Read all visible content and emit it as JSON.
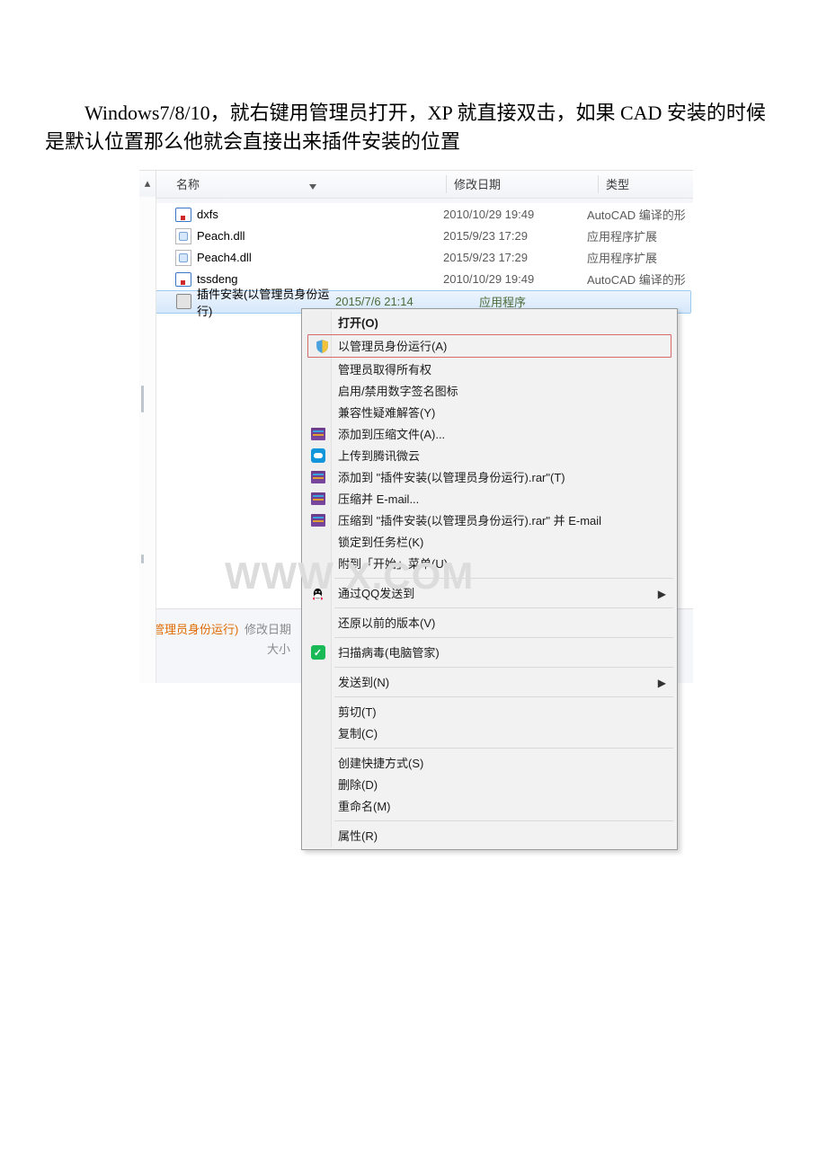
{
  "instruction": "Windows7/8/10，就右键用管理员打开，XP 就直接双击，如果 CAD 安装的时候是默认位置那么他就会直接出来插件安装的位置",
  "headers": {
    "name": "名称",
    "date": "修改日期",
    "type": "类型"
  },
  "files": [
    {
      "icon": "shx",
      "name": "dxfs",
      "date": "2010/10/29 19:49",
      "type": "AutoCAD 编译的形"
    },
    {
      "icon": "dll",
      "name": "Peach.dll",
      "date": "2015/9/23 17:29",
      "type": "应用程序扩展"
    },
    {
      "icon": "dll",
      "name": "Peach4.dll",
      "date": "2015/9/23 17:29",
      "type": "应用程序扩展"
    },
    {
      "icon": "shx",
      "name": "tssdeng",
      "date": "2010/10/29 19:49",
      "type": "AutoCAD 编译的形"
    },
    {
      "icon": "exe",
      "name": "插件安装(以管理员身份运行)",
      "date": "2015/7/6 21:14",
      "type": "应用程序",
      "selected": true
    }
  ],
  "status": {
    "name_suffix": "以管理员身份运行)",
    "mod_label": "修改日期",
    "size_label": "大小"
  },
  "menu": {
    "open": "打开(O)",
    "run_admin": "以管理员身份运行(A)",
    "take_owner": "管理员取得所有权",
    "sig_toggle": "启用/禁用数字签名图标",
    "compat": "兼容性疑难解答(Y)",
    "add_arch": "添加到压缩文件(A)...",
    "weiyun": "上传到腾讯微云",
    "add_rar": "添加到 \"插件安装(以管理员身份运行).rar\"(T)",
    "email_zip": "压缩并 E-mail...",
    "rar_email": "压缩到 \"插件安装(以管理员身份运行).rar\" 并 E-mail",
    "pin_task": "锁定到任务栏(K)",
    "pin_start": "附到「开始」菜单(U)",
    "qq_send": "通过QQ发送到",
    "restore": "还原以前的版本(V)",
    "av_scan": "扫描病毒(电脑管家)",
    "send_to": "发送到(N)",
    "cut": "剪切(T)",
    "copy": "复制(C)",
    "shortcut": "创建快捷方式(S)",
    "delete": "删除(D)",
    "rename": "重命名(M)",
    "properties": "属性(R)"
  },
  "watermark": "WWW              X.COM"
}
